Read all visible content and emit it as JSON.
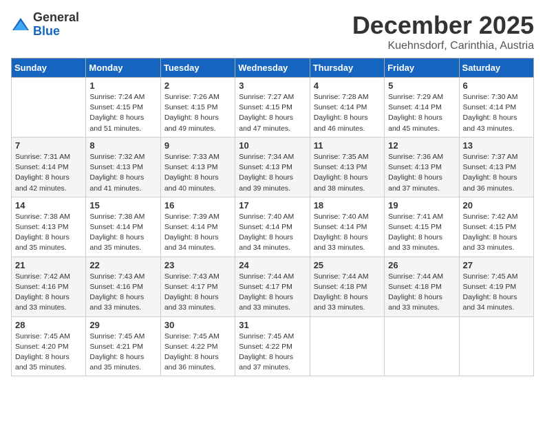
{
  "header": {
    "logo": {
      "general": "General",
      "blue": "Blue"
    },
    "month": "December 2025",
    "location": "Kuehnsdorf, Carinthia, Austria"
  },
  "weekdays": [
    "Sunday",
    "Monday",
    "Tuesday",
    "Wednesday",
    "Thursday",
    "Friday",
    "Saturday"
  ],
  "weeks": [
    [
      {
        "day": "",
        "empty": true
      },
      {
        "day": "1",
        "sunrise": "7:24 AM",
        "sunset": "4:15 PM",
        "daylight": "8 hours and 51 minutes."
      },
      {
        "day": "2",
        "sunrise": "7:26 AM",
        "sunset": "4:15 PM",
        "daylight": "8 hours and 49 minutes."
      },
      {
        "day": "3",
        "sunrise": "7:27 AM",
        "sunset": "4:15 PM",
        "daylight": "8 hours and 47 minutes."
      },
      {
        "day": "4",
        "sunrise": "7:28 AM",
        "sunset": "4:14 PM",
        "daylight": "8 hours and 46 minutes."
      },
      {
        "day": "5",
        "sunrise": "7:29 AM",
        "sunset": "4:14 PM",
        "daylight": "8 hours and 45 minutes."
      },
      {
        "day": "6",
        "sunrise": "7:30 AM",
        "sunset": "4:14 PM",
        "daylight": "8 hours and 43 minutes."
      }
    ],
    [
      {
        "day": "7",
        "sunrise": "7:31 AM",
        "sunset": "4:14 PM",
        "daylight": "8 hours and 42 minutes."
      },
      {
        "day": "8",
        "sunrise": "7:32 AM",
        "sunset": "4:13 PM",
        "daylight": "8 hours and 41 minutes."
      },
      {
        "day": "9",
        "sunrise": "7:33 AM",
        "sunset": "4:13 PM",
        "daylight": "8 hours and 40 minutes."
      },
      {
        "day": "10",
        "sunrise": "7:34 AM",
        "sunset": "4:13 PM",
        "daylight": "8 hours and 39 minutes."
      },
      {
        "day": "11",
        "sunrise": "7:35 AM",
        "sunset": "4:13 PM",
        "daylight": "8 hours and 38 minutes."
      },
      {
        "day": "12",
        "sunrise": "7:36 AM",
        "sunset": "4:13 PM",
        "daylight": "8 hours and 37 minutes."
      },
      {
        "day": "13",
        "sunrise": "7:37 AM",
        "sunset": "4:13 PM",
        "daylight": "8 hours and 36 minutes."
      }
    ],
    [
      {
        "day": "14",
        "sunrise": "7:38 AM",
        "sunset": "4:13 PM",
        "daylight": "8 hours and 35 minutes."
      },
      {
        "day": "15",
        "sunrise": "7:38 AM",
        "sunset": "4:14 PM",
        "daylight": "8 hours and 35 minutes."
      },
      {
        "day": "16",
        "sunrise": "7:39 AM",
        "sunset": "4:14 PM",
        "daylight": "8 hours and 34 minutes."
      },
      {
        "day": "17",
        "sunrise": "7:40 AM",
        "sunset": "4:14 PM",
        "daylight": "8 hours and 34 minutes."
      },
      {
        "day": "18",
        "sunrise": "7:40 AM",
        "sunset": "4:14 PM",
        "daylight": "8 hours and 33 minutes."
      },
      {
        "day": "19",
        "sunrise": "7:41 AM",
        "sunset": "4:15 PM",
        "daylight": "8 hours and 33 minutes."
      },
      {
        "day": "20",
        "sunrise": "7:42 AM",
        "sunset": "4:15 PM",
        "daylight": "8 hours and 33 minutes."
      }
    ],
    [
      {
        "day": "21",
        "sunrise": "7:42 AM",
        "sunset": "4:16 PM",
        "daylight": "8 hours and 33 minutes."
      },
      {
        "day": "22",
        "sunrise": "7:43 AM",
        "sunset": "4:16 PM",
        "daylight": "8 hours and 33 minutes."
      },
      {
        "day": "23",
        "sunrise": "7:43 AM",
        "sunset": "4:17 PM",
        "daylight": "8 hours and 33 minutes."
      },
      {
        "day": "24",
        "sunrise": "7:44 AM",
        "sunset": "4:17 PM",
        "daylight": "8 hours and 33 minutes."
      },
      {
        "day": "25",
        "sunrise": "7:44 AM",
        "sunset": "4:18 PM",
        "daylight": "8 hours and 33 minutes."
      },
      {
        "day": "26",
        "sunrise": "7:44 AM",
        "sunset": "4:18 PM",
        "daylight": "8 hours and 33 minutes."
      },
      {
        "day": "27",
        "sunrise": "7:45 AM",
        "sunset": "4:19 PM",
        "daylight": "8 hours and 34 minutes."
      }
    ],
    [
      {
        "day": "28",
        "sunrise": "7:45 AM",
        "sunset": "4:20 PM",
        "daylight": "8 hours and 35 minutes."
      },
      {
        "day": "29",
        "sunrise": "7:45 AM",
        "sunset": "4:21 PM",
        "daylight": "8 hours and 35 minutes."
      },
      {
        "day": "30",
        "sunrise": "7:45 AM",
        "sunset": "4:22 PM",
        "daylight": "8 hours and 36 minutes."
      },
      {
        "day": "31",
        "sunrise": "7:45 AM",
        "sunset": "4:22 PM",
        "daylight": "8 hours and 37 minutes."
      },
      {
        "day": "",
        "empty": true
      },
      {
        "day": "",
        "empty": true
      },
      {
        "day": "",
        "empty": true
      }
    ]
  ]
}
